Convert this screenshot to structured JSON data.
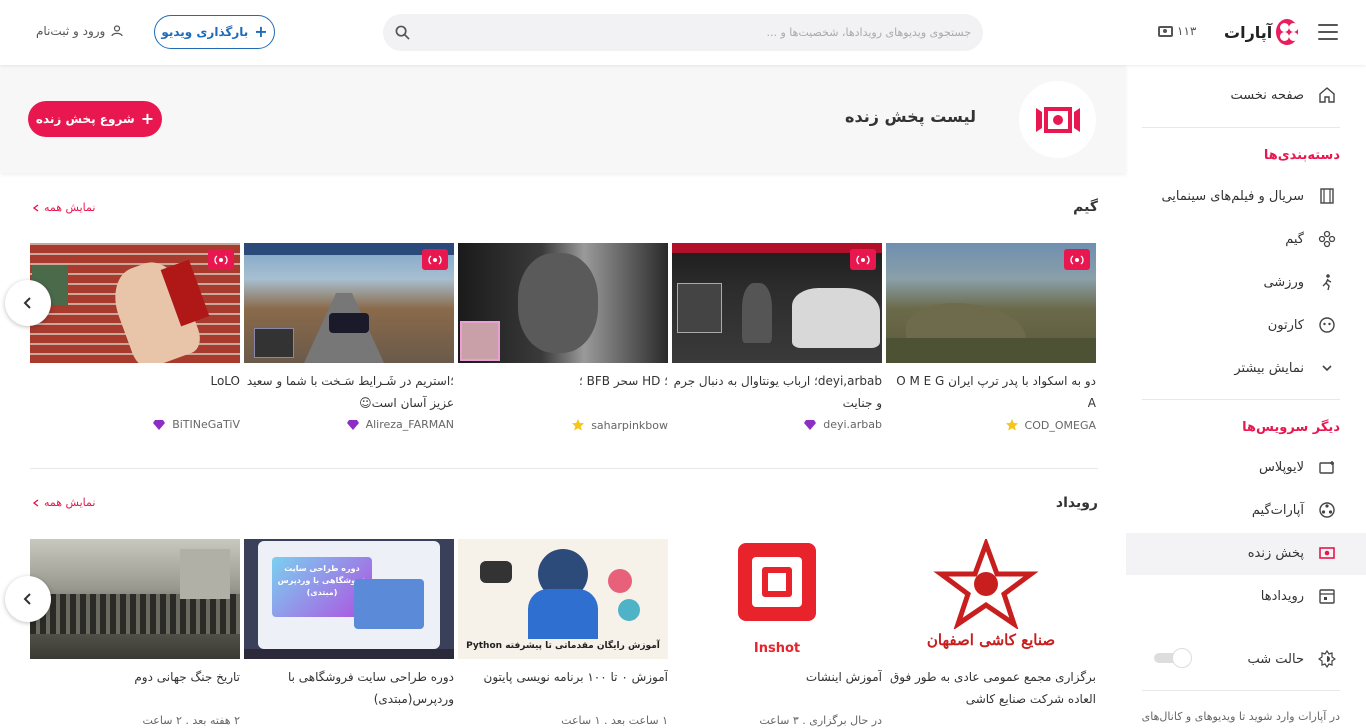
{
  "header": {
    "logo_text": "آپارات",
    "count": "۱۱۳",
    "search_placeholder": "جستجوی ویدیوهای رویدادها، شخصیت‌ها و ...",
    "upload_label": "بارگذاری ویدیو",
    "login_label": "ورود و ثبت‌نام"
  },
  "sidebar": {
    "home": "صفحه نخست",
    "categories_title": "دسته‌بندی‌ها",
    "cat_series": "سریال و فیلم‌های سینمایی",
    "cat_game": "گیم",
    "cat_sport": "ورزشی",
    "cat_cartoon": "کارتون",
    "cat_more": "نمایش بیشتر",
    "services_title": "دیگر سرویس‌ها",
    "svc_liveplus": "لایوپلاس",
    "svc_aparatgame": "آپارات‌گیم",
    "svc_live": "پخش زنده",
    "svc_events": "رویدادها",
    "night_mode": "حالت شب",
    "note": "در آپارات وارد شوید تا ویدیوهای و کانال‌های"
  },
  "hero": {
    "title": "لیست پخش زنده",
    "start_live": "شروع پخش زنده"
  },
  "sections": {
    "game": {
      "title": "گیم",
      "show_all": "نمایش همه",
      "cards": [
        {
          "title": "دو به اسکواد با پدر ترپ ایران O M E G A",
          "channel": "COD_OMEGA",
          "badge": "star"
        },
        {
          "title": "deyi,arbab؛ ارباب یونتاوال به دنبال جرم و جنایت",
          "channel": "deyi.arbab",
          "badge": "gem"
        },
        {
          "title": "؛ HD سحر BFB ؛",
          "channel": "saharpinkbow",
          "badge": "star"
        },
        {
          "title": "؛استریم در شَـرایط سَـخت با شما و سعید عزیز آسان است☺",
          "channel": "Alireza_FARMAN",
          "badge": "gem"
        },
        {
          "title": "LoLO",
          "channel": "BiTINeGaTiV",
          "badge": "gem"
        }
      ]
    },
    "event": {
      "title": "رویداد",
      "show_all": "نمایش همه",
      "cards": [
        {
          "title": "برگزاری مجمع عمومی عادی به طور فوق العاده شرکت صنایع کاشی",
          "meta": ""
        },
        {
          "title": "آموزش اینشات",
          "meta": "در حال برگزاری . ۳ ساعت"
        },
        {
          "title": "آموزش ۰ تا ۱۰۰ برنامه نویسی پایتون",
          "meta": "۱ ساعت بعد . ۱ ساعت"
        },
        {
          "title": "دوره طراحی سایت فروشگاهی با وردپرس(مبتدی)",
          "meta": ""
        },
        {
          "title": "تاریخ جنگ جهانی دوم",
          "meta": "۲ هفته بعد . ۲ ساعت"
        }
      ]
    }
  },
  "thumb_text": {
    "inshot": "Inshot",
    "python": "آموزش رایگان مقدماتی تا پیشرفته Python",
    "kashi": "صنایع کاشی اصفهان",
    "wp": "دوره طراحی سایت فروشگاهی با وردپرس (مبتدی)"
  },
  "colors": {
    "accent": "#e8174f",
    "blue": "#1e6bb8"
  }
}
